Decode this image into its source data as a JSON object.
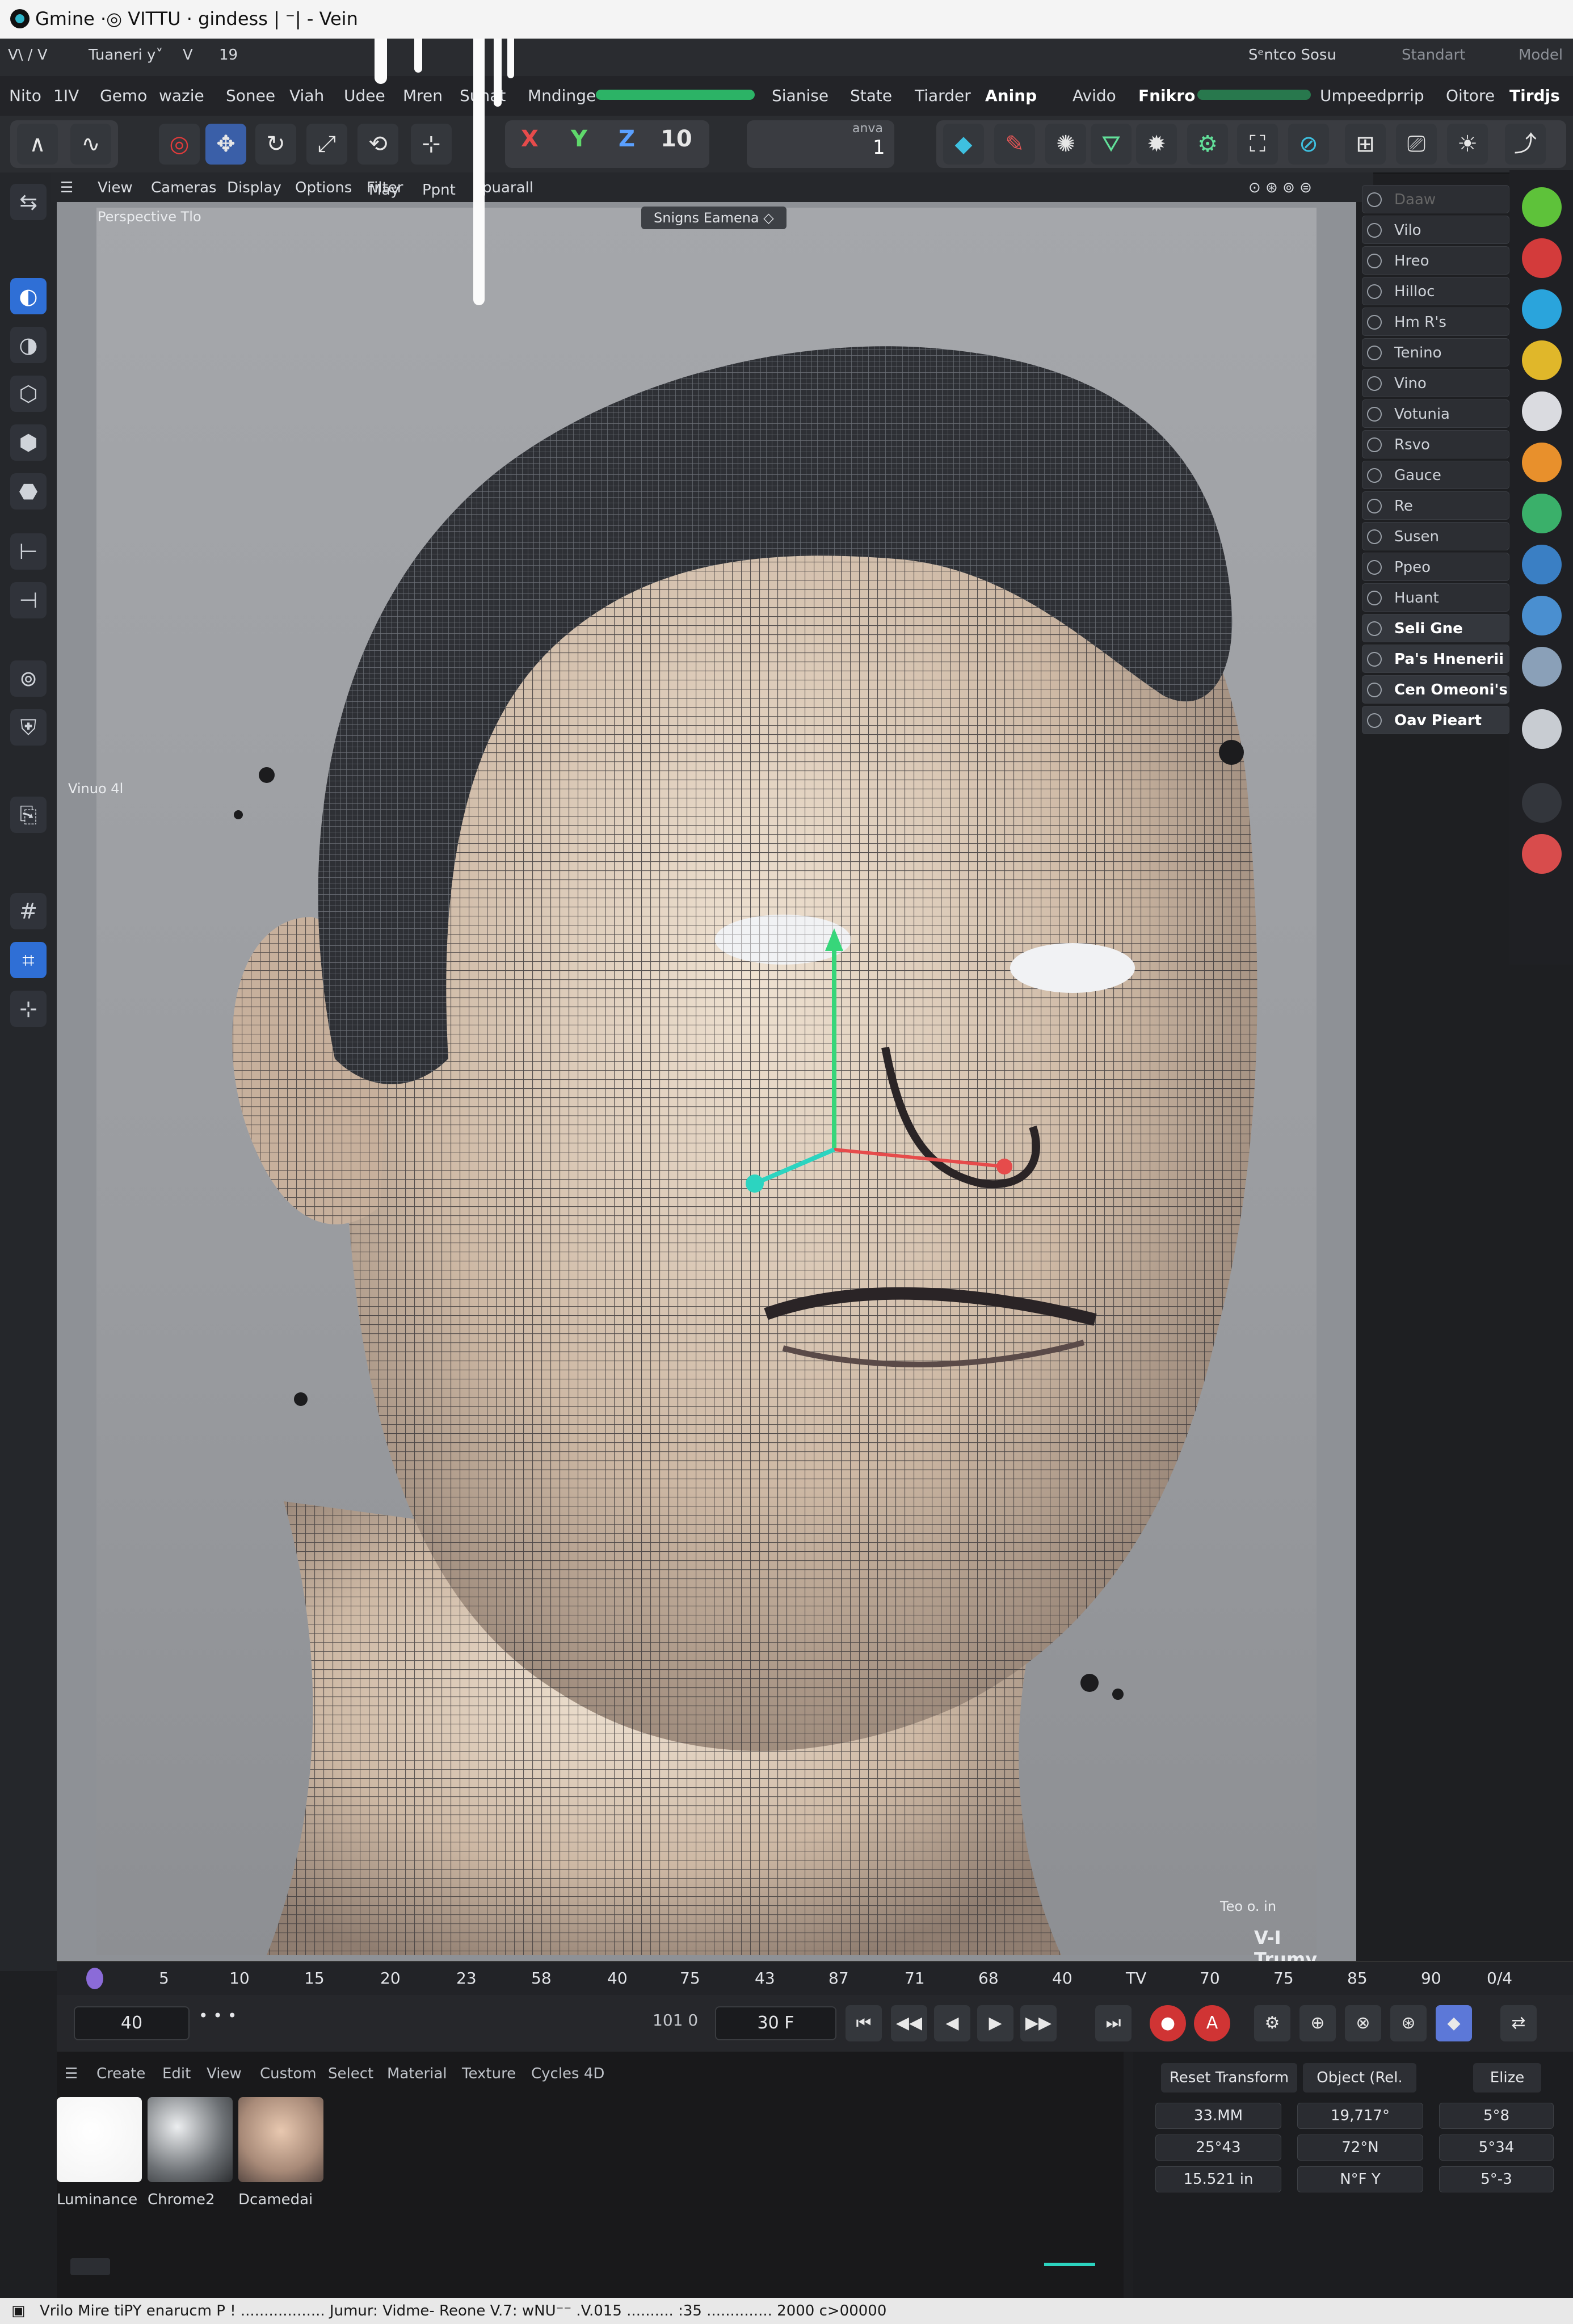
{
  "window": {
    "title": "Gmine ·◎ VITTU · gindess | ⁻| - Vein"
  },
  "topstrip": {
    "left_items": [
      "V\\ / V",
      "Tuaneri y˅",
      "V",
      "19"
    ],
    "right_items": [
      "Sᵉntco Sosu",
      "Standart",
      "Model"
    ]
  },
  "menubar": {
    "items": [
      "Nito",
      "1IV",
      "Gemo",
      "wazie",
      "Sonee",
      "Viah",
      "Udee",
      "Mren",
      "Sunat",
      "Mndinge",
      "Sianise",
      "State",
      "Tiarder",
      "Aninp",
      "Avido",
      "Fnikro",
      "Umpeedprrip",
      "Oitore",
      "Tirdjs"
    ]
  },
  "toolbar": {
    "axes": [
      "X",
      "Y",
      "Z"
    ],
    "counter_label": "10",
    "field_label": "anva",
    "field_value": "1"
  },
  "viewport_menu": {
    "items": [
      "View",
      "Cameras",
      "Display",
      "Options",
      "Filter",
      "May",
      "Ppnt",
      "puarall"
    ]
  },
  "viewport": {
    "view_label": "Perspective  Tlo",
    "camera_badge": "Snigns Eamena ◇",
    "side_label": "Vinuo 4l",
    "corner_label": "V-I Trumy",
    "corner_small": "Teo o.  in",
    "subject": "3D head mesh with dense wireframe"
  },
  "rightlist": {
    "items": [
      "Daaw",
      "Vilo",
      "Hreo",
      "Hilloc",
      "Hm R's",
      "Tenino",
      "Vino",
      "Votunia",
      "Rsvo",
      "Gauce",
      "Re",
      "Susen",
      "Ppeo",
      "Huant",
      "Seli Gne",
      "Pa's Hnenerii",
      "Cen Omeoni's",
      "Oav Pieart"
    ],
    "highlighted_from": 14
  },
  "timeline": {
    "ticks": [
      "0",
      "5",
      "10",
      "15",
      "20",
      "23",
      "58",
      "40",
      "75",
      "43",
      "87",
      "71",
      "68",
      "40",
      "TV",
      "70",
      "75",
      "85",
      "90",
      "0/4"
    ]
  },
  "transport": {
    "current_frame": "40",
    "end_frame": "101 0",
    "fps_field": "30 F",
    "buttons": [
      "⏮",
      "◀◀",
      "◀",
      "▶",
      "▶▶",
      "⏭"
    ]
  },
  "matmgr": {
    "menu": [
      "Create",
      "Edit",
      "View",
      "Custom",
      "Select",
      "Material",
      "Texture",
      "Cycles 4D"
    ],
    "materials": [
      "Luminance",
      "Chrome2",
      "Dcamedai"
    ]
  },
  "attrs": {
    "buttons": [
      "Reset Transform",
      "Object (Rel.",
      "Elize"
    ],
    "rows": [
      [
        "33.MM",
        "19,717°",
        "5°8"
      ],
      [
        "25°43",
        "72°N",
        "5°34"
      ],
      [
        "15.521 in",
        "N°F Y",
        "5°-3"
      ]
    ]
  },
  "statusbar": {
    "text": "Vrilo Mire tiPY  enarucm P !  ..................  Jumur: Vidme- Reone  V.7: wNU⁻⁻   .V.015 ..........  :35 .............. 2000 c>00000"
  }
}
